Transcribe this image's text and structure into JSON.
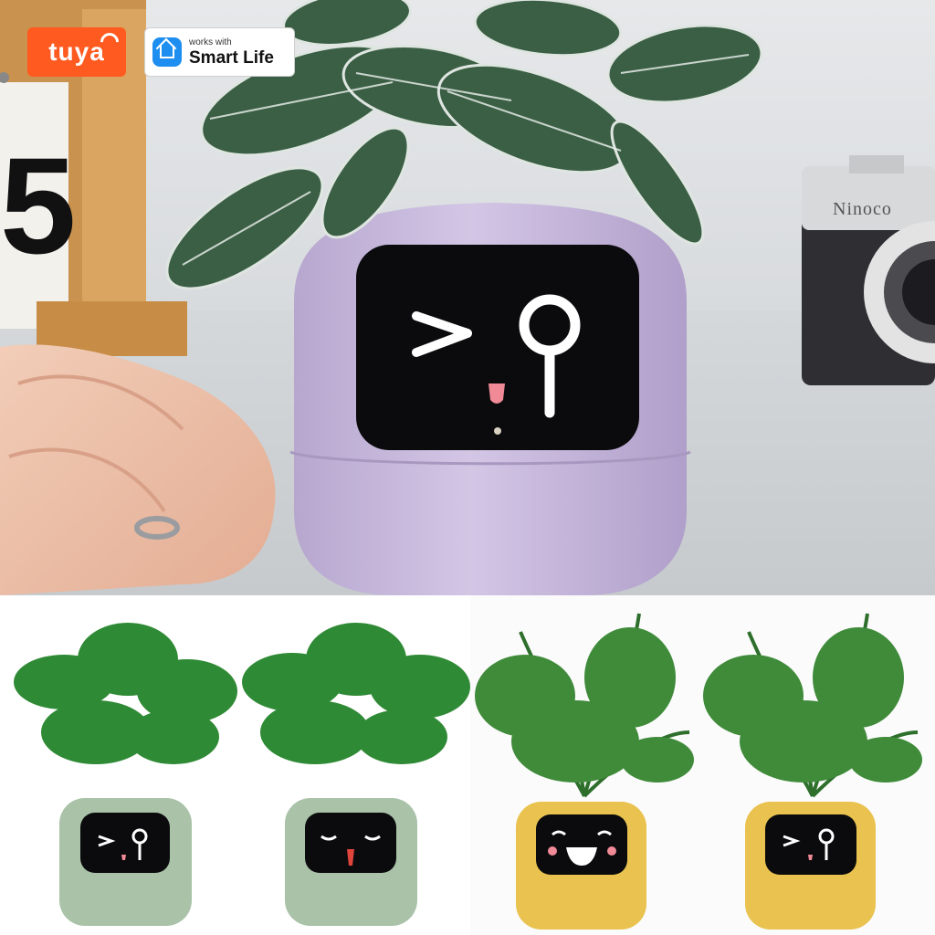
{
  "badges": {
    "brand_text": "tuya",
    "works_with_text": "works with",
    "app_text": "Smart Life"
  },
  "scene": {
    "calendar_digit": "5",
    "camera_brand": "Ninoco"
  },
  "colors": {
    "tuya_orange": "#ff5a1f",
    "smart_life_blue": "#1e8ef0",
    "pot_purple": "#c7b8dc",
    "pot_green": "#a9c2a8",
    "pot_yellow": "#e9c24f",
    "screen_black": "#0b0b0d"
  },
  "icons": [
    "wifi-icon",
    "smart-life-house-icon"
  ]
}
